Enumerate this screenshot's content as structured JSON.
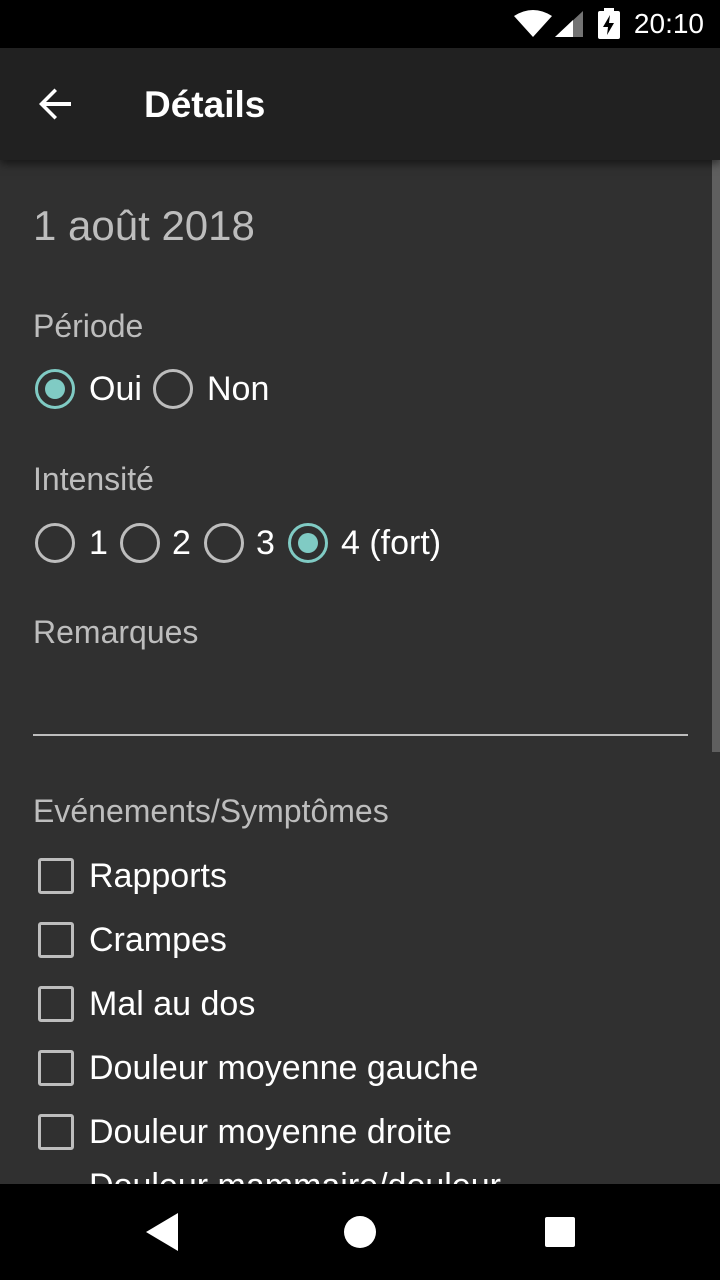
{
  "status_bar": {
    "time": "20:10"
  },
  "app_bar": {
    "title": "Détails"
  },
  "date": "1 août 2018",
  "periode": {
    "label": "Période",
    "options": [
      {
        "label": "Oui",
        "checked": true
      },
      {
        "label": "Non",
        "checked": false
      }
    ]
  },
  "intensite": {
    "label": "Intensité",
    "options": [
      {
        "label": "1",
        "checked": false
      },
      {
        "label": "2",
        "checked": false
      },
      {
        "label": "3",
        "checked": false
      },
      {
        "label": "4 (fort)",
        "checked": true
      }
    ]
  },
  "remarques": {
    "label": "Remarques",
    "value": ""
  },
  "evenements": {
    "label": "Evénements/Symptômes",
    "items": [
      {
        "label": "Rapports",
        "checked": false
      },
      {
        "label": "Crampes",
        "checked": false
      },
      {
        "label": "Mal au dos",
        "checked": false
      },
      {
        "label": "Douleur moyenne gauche",
        "checked": false
      },
      {
        "label": "Douleur moyenne droite",
        "checked": false
      },
      {
        "label": "Douleur mammaire/douleur",
        "checked": false
      }
    ]
  },
  "colors": {
    "accent": "#80cbc4",
    "background": "#303030",
    "appbar": "#212121"
  }
}
